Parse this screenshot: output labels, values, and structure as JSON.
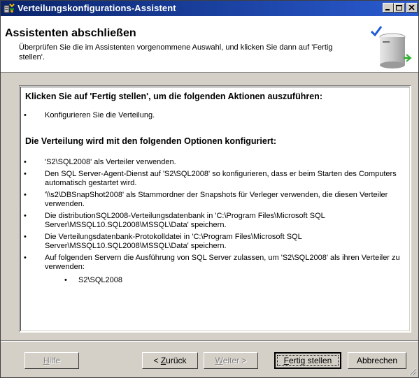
{
  "window": {
    "title": "Verteilungskonfigurations-Assistent"
  },
  "header": {
    "title": "Assistenten abschließen",
    "description": "Überprüfen Sie die im Assistenten vorgenommene Auswahl, und klicken Sie dann auf 'Fertig stellen'."
  },
  "summary": {
    "heading1": "Klicken Sie auf 'Fertig stellen', um die folgenden Aktionen auszuführen:",
    "actions": [
      "Konfigurieren Sie die Verteilung."
    ],
    "heading2": "Die Verteilung wird mit den folgenden Optionen konfiguriert:",
    "options": [
      "'S2\\SQL2008' als Verteiler verwenden.",
      "Den SQL Server-Agent-Dienst auf 'S2\\SQL2008' so konfigurieren, dass er beim Starten des Computers automatisch gestartet wird.",
      "'\\\\s2\\DBSnapShot2008' als Stammordner der Snapshots für Verleger verwenden, die diesen Verteiler verwenden.",
      "Die distributionSQL2008-Verteilungsdatenbank in 'C:\\Program Files\\Microsoft SQL Server\\MSSQL10.SQL2008\\MSSQL\\Data' speichern.",
      "Die Verteilungsdatenbank-Protokolldatei in 'C:\\Program Files\\Microsoft SQL Server\\MSSQL10.SQL2008\\MSSQL\\Data' speichern.",
      "Auf folgenden Servern die Ausführung von SQL Server zulassen, um 'S2\\SQL2008' als ihren Verteiler zu verwenden:"
    ],
    "bullet_char": "•",
    "servers": [
      "S2\\SQL2008"
    ]
  },
  "buttons": {
    "help": {
      "pre": "",
      "key": "H",
      "post": "ilfe"
    },
    "back": {
      "pre": "< ",
      "key": "Z",
      "post": "urück"
    },
    "next": {
      "pre": "",
      "key": "W",
      "post": "eiter >"
    },
    "finish": {
      "pre": "",
      "key": "F",
      "post": "ertig stellen"
    },
    "cancel": "Abbrechen"
  },
  "colors": {
    "titlebar_start": "#0a246a",
    "titlebar_end": "#2a5bd0",
    "face": "#d4d0c8"
  }
}
